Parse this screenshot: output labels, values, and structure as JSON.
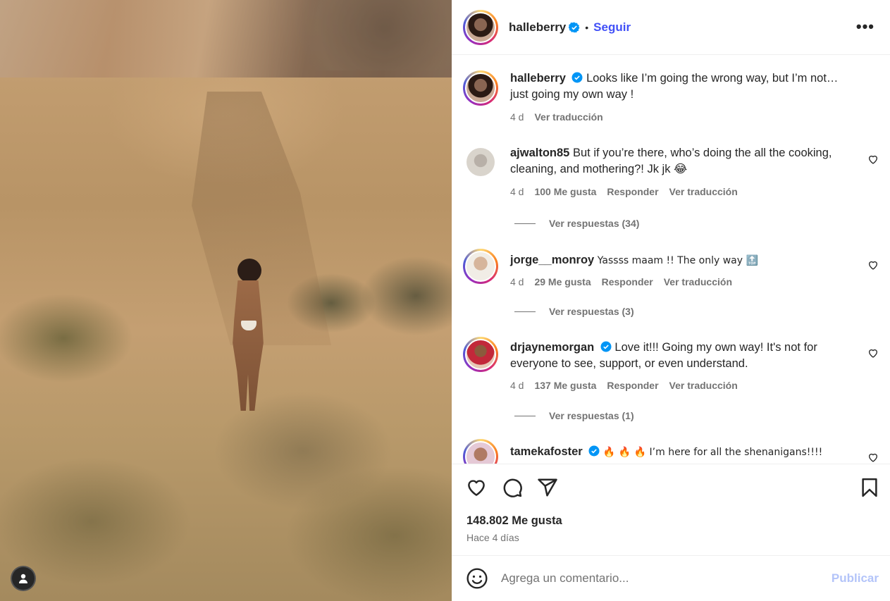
{
  "post": {
    "author": "halleberry",
    "follow_label": "Seguir",
    "separator": "•",
    "more_label": "•••",
    "likes": "148.802 Me gusta",
    "posted_ago": "Hace 4 días"
  },
  "caption": {
    "user": "halleberry",
    "text": "Looks like I’m going the wrong way, but I’m not…just going my own way !",
    "time": "4 d",
    "translate": "Ver traducción"
  },
  "comments": [
    {
      "user": "ajwalton85",
      "text": "But if you’re there, who’s doing the all the cooking, cleaning, and mothering?! Jk jk 😂",
      "time": "4 d",
      "likes": "100 Me gusta",
      "reply": "Responder",
      "translate": "Ver traducción",
      "view_replies": "Ver respuestas (34)"
    },
    {
      "user": "jorge__monroy",
      "text": "Yassss maam !! The only way 🔝",
      "time": "4 d",
      "likes": "29 Me gusta",
      "reply": "Responder",
      "translate": "Ver traducción",
      "view_replies": "Ver respuestas (3)"
    },
    {
      "user": "drjaynemorgan",
      "text": "Love it!!! Going my own way! It's not for everyone to see, support, or even understand.",
      "time": "4 d",
      "likes": "137 Me gusta",
      "reply": "Responder",
      "translate": "Ver traducción",
      "view_replies": "Ver respuestas (1)"
    },
    {
      "user": "tamekafoster",
      "text": "🔥 🔥 🔥  I’m here for all the shenanigans!!!!"
    }
  ],
  "composer": {
    "placeholder": "Agrega un comentario...",
    "publish_label": "Publicar"
  },
  "colors": {
    "link_blue": "#4150f7",
    "publish_disabled": "#b3c4f9",
    "verified_blue": "#0095f6",
    "muted_text": "#737373"
  }
}
